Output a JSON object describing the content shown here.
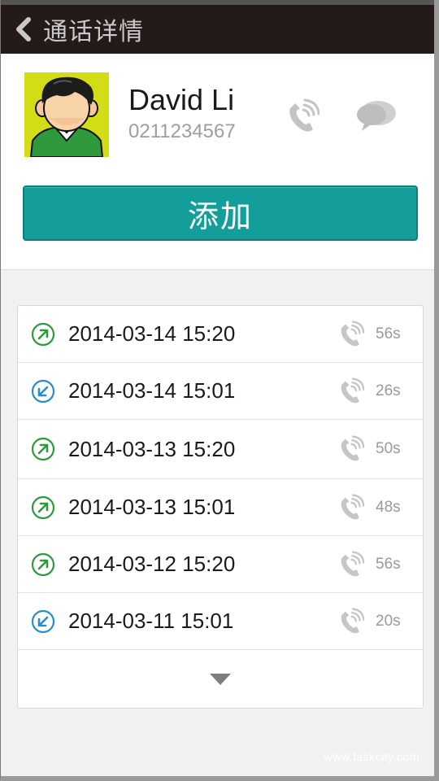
{
  "header": {
    "title": "通话详情",
    "back_icon": "chevron-left-icon"
  },
  "contact": {
    "name": "David Li",
    "phone": "0211234567",
    "avatar_icon": "boy-avatar",
    "call_icon": "phone-icon",
    "message_icon": "chat-bubble-icon",
    "add_label": "添加"
  },
  "calls": [
    {
      "direction": "outgoing",
      "datetime": "2014-03-14 15:20",
      "duration": "56s"
    },
    {
      "direction": "incoming",
      "datetime": "2014-03-14 15:01",
      "duration": "26s"
    },
    {
      "direction": "outgoing",
      "datetime": "2014-03-13 15:20",
      "duration": "50s"
    },
    {
      "direction": "outgoing",
      "datetime": "2014-03-13 15:01",
      "duration": "48s"
    },
    {
      "direction": "outgoing",
      "datetime": "2014-03-12 15:20",
      "duration": "56s"
    },
    {
      "direction": "incoming",
      "datetime": "2014-03-11 15:01",
      "duration": "20s"
    }
  ],
  "more_icon": "triangle-down-icon",
  "watermark": "www.taskcity.com",
  "colors": {
    "header_bg": "#241a18",
    "accent": "#139d9b",
    "outgoing": "#2e9a3e",
    "incoming": "#2a8fc4"
  }
}
